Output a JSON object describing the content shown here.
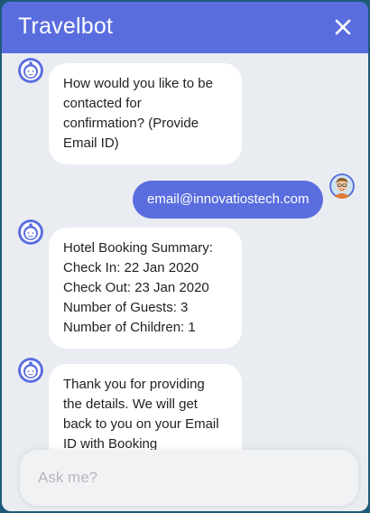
{
  "header": {
    "title": "Travelbot"
  },
  "input": {
    "placeholder": "Ask me?"
  },
  "messages": [
    {
      "from": "bot",
      "lines": [
        "How would you like to be",
        "contacted for",
        "confirmation? (Provide",
        "Email ID)"
      ]
    },
    {
      "from": "user",
      "text": "email@innovatiostech.com"
    },
    {
      "from": "bot",
      "lines": [
        "Hotel Booking Summary:",
        "Check In: 22 Jan 2020",
        "Check Out: 23 Jan 2020",
        "Number of Guests: 3",
        "Number of Children: 1"
      ]
    },
    {
      "from": "bot",
      "lines": [
        "Thank you for providing",
        "the details. We will get",
        "back to you on your Email",
        "ID with Booking"
      ]
    }
  ],
  "colors": {
    "accent": "#5a6ddf",
    "background": "#e9edf1",
    "bubble": "#ffffff"
  }
}
